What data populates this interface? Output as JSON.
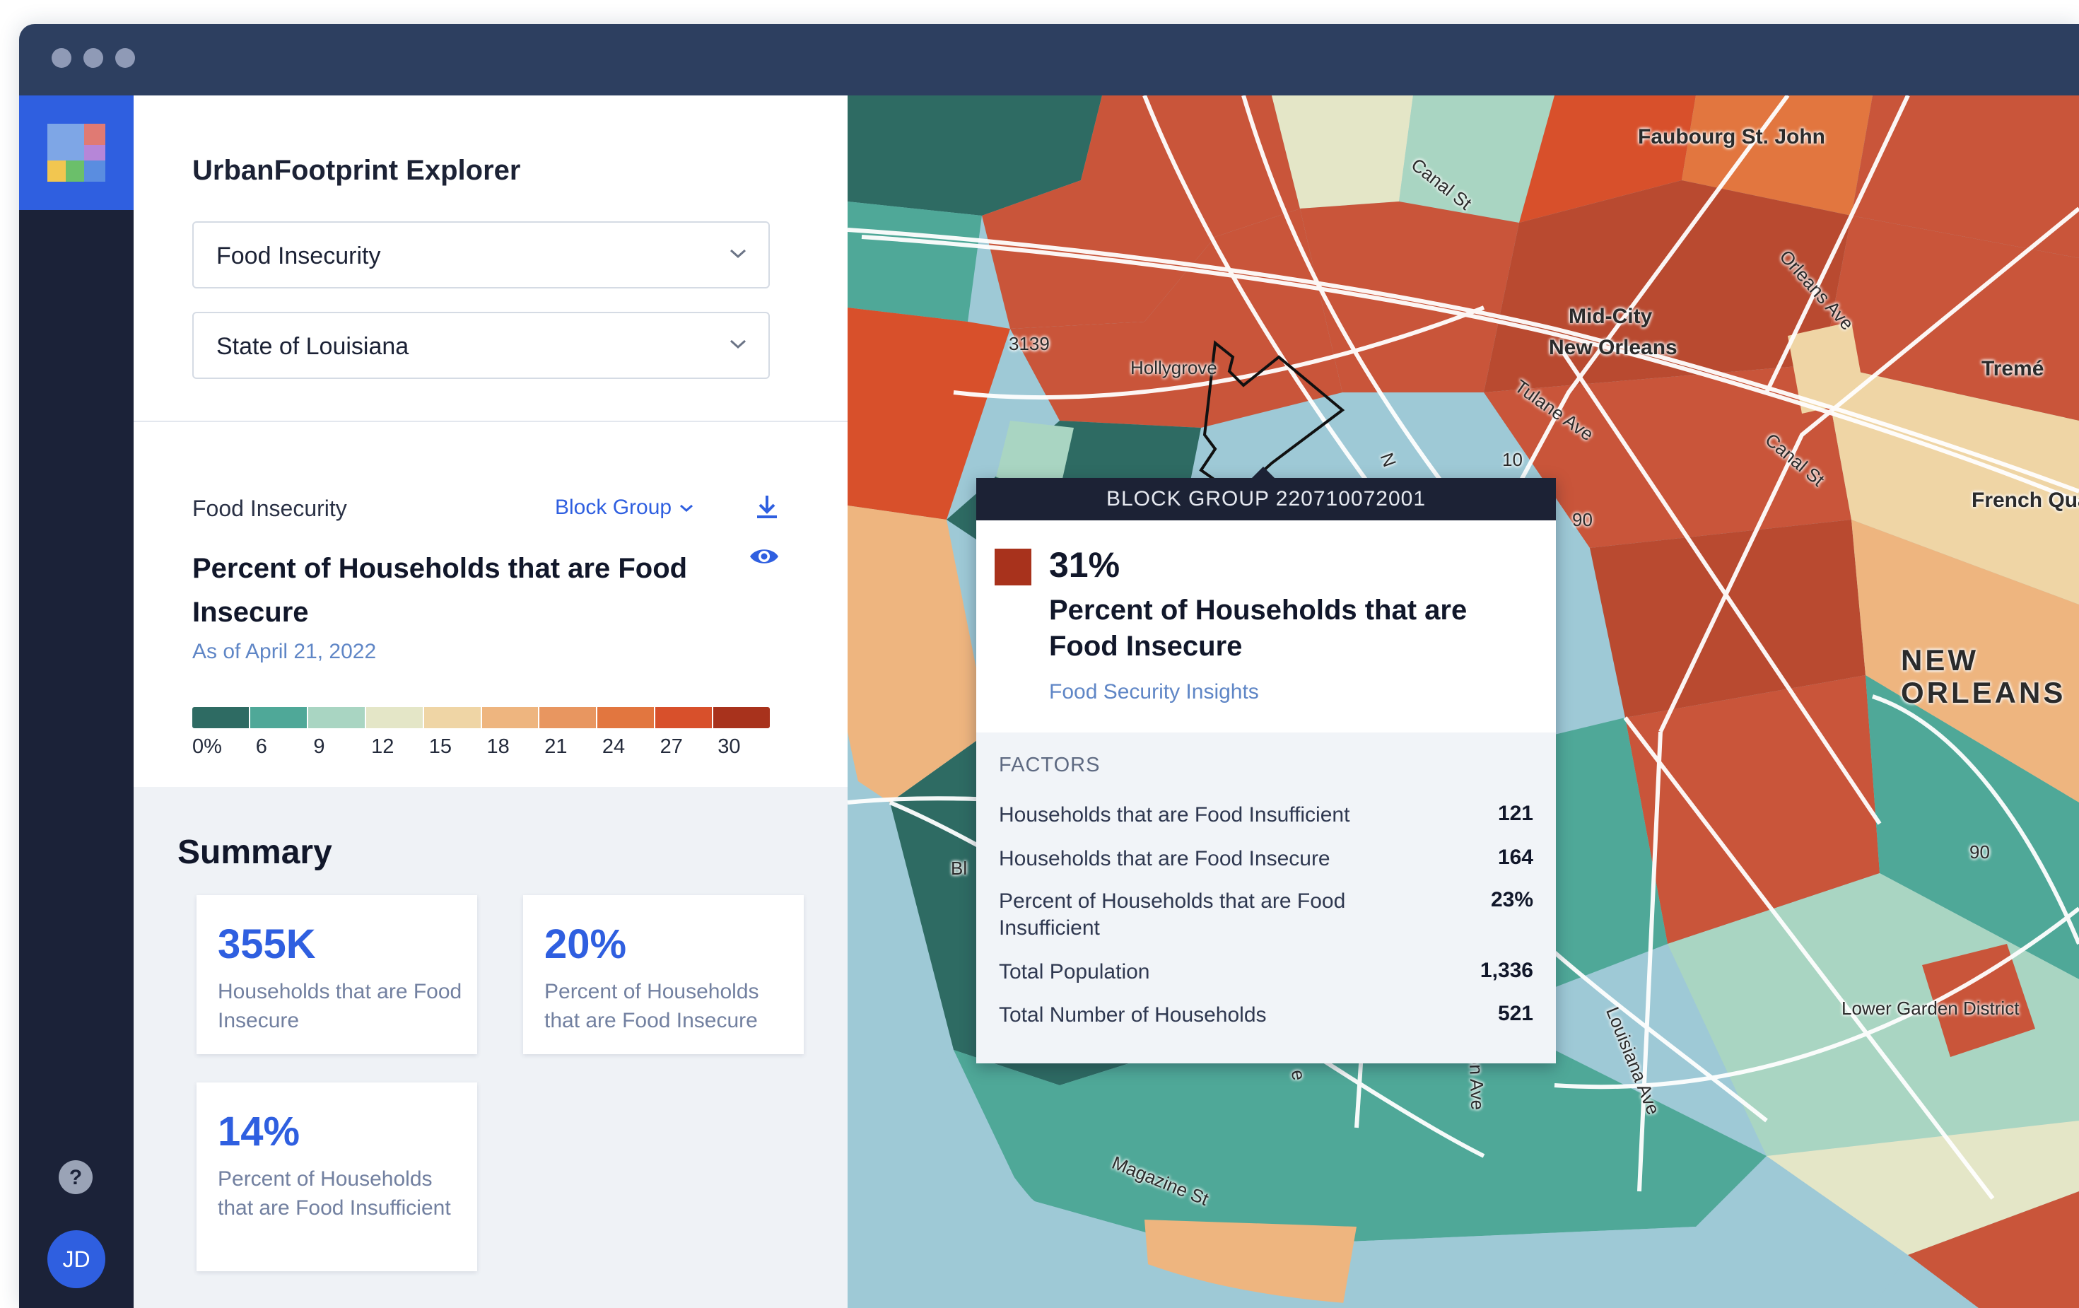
{
  "app": {
    "title": "UrbanFootprint Explorer"
  },
  "rail": {
    "avatar_initials": "JD",
    "icons": [
      "logo-icon",
      "help-icon"
    ]
  },
  "filters": {
    "dataset": "Food Insecurity",
    "region": "State of Louisiana"
  },
  "layer": {
    "name": "Food Insecurity",
    "geography": "Block Group",
    "metric_title": "Percent of Households that are Food Insecure",
    "as_of": "As of April 21, 2022",
    "legend_ticks": [
      "0%",
      "6",
      "9",
      "12",
      "15",
      "18",
      "21",
      "24",
      "27",
      "30"
    ],
    "legend_colors": [
      "#2e6b63",
      "#4fa898",
      "#a9d5c2",
      "#e4e6c7",
      "#efd5a5",
      "#eeb57f",
      "#e89660",
      "#e2763f",
      "#d8502b",
      "#a8321c"
    ]
  },
  "summary": {
    "heading": "Summary",
    "cards": [
      {
        "value": "355K",
        "label": "Households that are Food Insecure"
      },
      {
        "value": "20%",
        "label": "Percent of Households that are Food Insecure"
      },
      {
        "value": "14%",
        "label": "Percent of Households that are Food Insufficient"
      }
    ]
  },
  "map": {
    "labels": {
      "faubourg": "Faubourg St. John",
      "canal_st_1": "Canal St",
      "canal_st_2": "Canal St",
      "orleans_ave": "Orleans Ave",
      "mid_city_1": "Mid-City",
      "mid_city_2": "New Orleans",
      "hollygrove": "Hollygrove",
      "hwy_3139": "3139",
      "tulane_ave": "Tulane Ave",
      "treme": "Tremé",
      "french_quarter": "French Quar",
      "hwy_10": "10",
      "hwy_90a": "90",
      "hwy_90b": "90",
      "new_orleans_1": "NEW",
      "new_orleans_2": "ORLEANS",
      "lower_garden": "Lower Garden District",
      "magazine_st": "Magazine St",
      "louisiana_ave": "Louisiana Ave",
      "bl_fragment": "Bl",
      "n_fragment_1": "N",
      "e_fragment": "e",
      "on_ave_fragment": "on Ave"
    }
  },
  "tooltip": {
    "header": "BLOCK GROUP 220710072001",
    "swatch_color": "#a8321c",
    "value": "31%",
    "metric": "Percent of Households that are Food Insecure",
    "source": "Food Security Insights",
    "factors_heading": "FACTORS",
    "factors": [
      {
        "label": "Households that are Food Insufficient",
        "value": "121"
      },
      {
        "label": "Households that are Food Insecure",
        "value": "164"
      },
      {
        "label": "Percent of Households that are Food Insufficient",
        "value": "23%"
      },
      {
        "label": "Total Population",
        "value": "1,336"
      },
      {
        "label": "Total Number of Households",
        "value": "521"
      }
    ]
  }
}
